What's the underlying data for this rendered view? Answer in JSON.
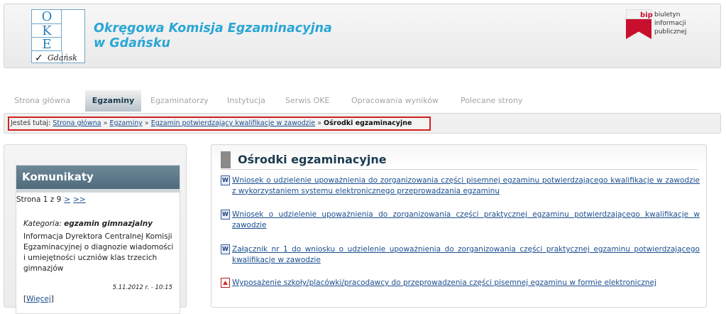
{
  "header": {
    "logo": {
      "letters": [
        "O",
        "K",
        "E"
      ],
      "city": "Gdańsk",
      "check": "✓"
    },
    "title_line1": "Okręgowa Komisja Egzaminacyjna",
    "title_line2": "w Gdańsku",
    "bip": {
      "letters": "bip",
      "line1": "biuletyn",
      "line2": "informacji publicznej"
    },
    "accent_color": "#2aa6d6"
  },
  "nav": {
    "items": [
      {
        "label": "Strona główna",
        "active": false
      },
      {
        "label": "Egzaminy",
        "active": true
      },
      {
        "label": "Egzaminatorzy",
        "active": false
      },
      {
        "label": "Instytucja",
        "active": false
      },
      {
        "label": "Serwis OKE",
        "active": false
      },
      {
        "label": "Opracowania wyników",
        "active": false
      },
      {
        "label": "Polecane strony",
        "active": false
      }
    ]
  },
  "breadcrumb": {
    "prefix": "Jesteś tutaj:",
    "links": [
      "Strona główna",
      "Egzaminy",
      "Egzamin potwierdzający kwalifikacje w zawodzie"
    ],
    "separator": "»",
    "current": "Ośrodki egzaminacyjne"
  },
  "komunikaty": {
    "title": "Komunikaty",
    "pager_text": "Strona 1 z 9",
    "pager_next": ">",
    "pager_last": ">>",
    "category_label": "Kategoria:",
    "category_value": "egzamin gimnazjalny",
    "text": "Informacja Dyrektora Centralnej Komisji Egzaminacyjnej o diagnozie wiadomości i umiejętności uczniów klas trzecich gimnazjów",
    "date": "5.11.2012 r. - 10:15",
    "more_label": "Więcej"
  },
  "main": {
    "title": "Ośrodki egzaminacyjne",
    "documents": [
      {
        "icon": "word-doc-icon",
        "text": "Wniosek o udzielenie upoważnienia do zorganizowania części pisemnej egzaminu potwierdzającego kwalifikacje w zawodzie z wykorzystaniem systemu elektronicznego przeprowadzania egzaminu"
      },
      {
        "icon": "word-doc-icon",
        "text": "Wniosek o udzielenie upoważnienia do zorganizowania części praktycznej egzaminu potwierdzającego kwalifikacje w zawodzie"
      },
      {
        "icon": "word-doc-icon",
        "text": "Załącznik nr 1 do wniosku o udzielenie upoważnienia do zorganizowania części praktycznej egzaminu potwierdzającego kwalifikacje w zawodzie"
      },
      {
        "icon": "pdf-doc-icon",
        "text": "Wyposażenie szkoły/placówki/pracodawcy do przeprowadzenia części pisemnej egzaminu w formie elektronicznej"
      }
    ]
  }
}
